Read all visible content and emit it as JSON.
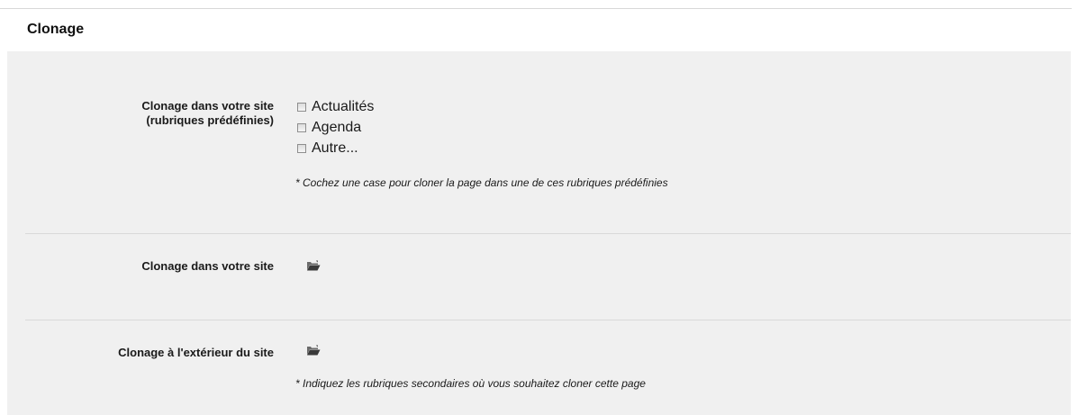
{
  "section": {
    "title": "Clonage"
  },
  "rows": {
    "predefined": {
      "label_line1": "Clonage dans votre site",
      "label_line2": "(rubriques prédéfinies)",
      "options": [
        {
          "label": "Actualités",
          "checked": false
        },
        {
          "label": "Agenda",
          "checked": false
        },
        {
          "label": "Autre...",
          "checked": false
        }
      ],
      "hint": "* Cochez une case pour cloner la page dans une de ces rubriques prédéfinies"
    },
    "internal": {
      "label": "Clonage dans votre site",
      "icon": "folder-open-icon"
    },
    "external": {
      "label": "Clonage à l'extérieur du site",
      "icon": "folder-open-icon",
      "hint": "* Indiquez les rubriques secondaires où vous souhaitez cloner cette page"
    }
  },
  "colors": {
    "panel_background": "#f0f0f0",
    "divider": "#d9d9d9"
  }
}
